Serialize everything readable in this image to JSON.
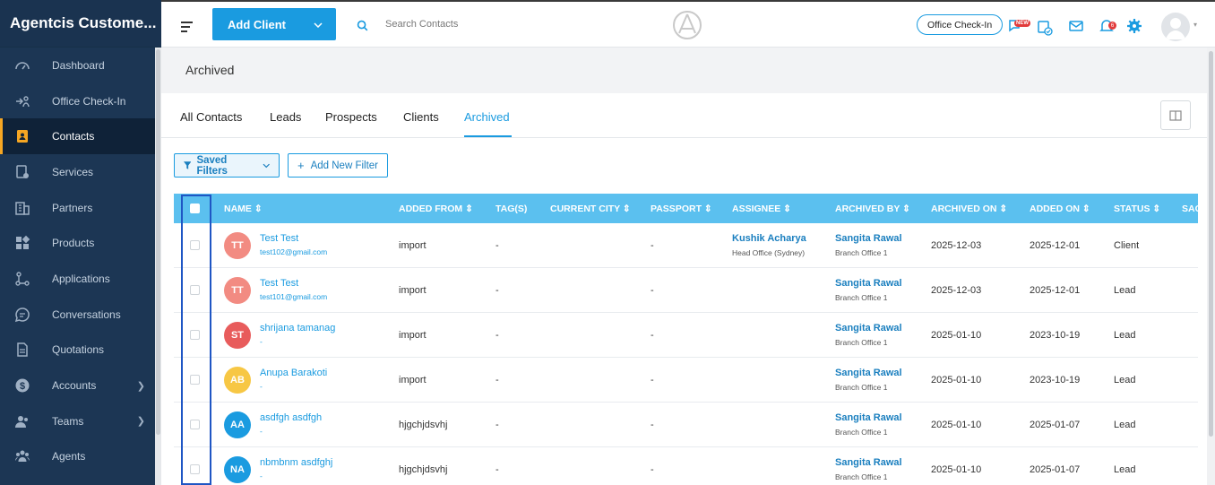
{
  "brand": {
    "title": "Agentcis Custome..."
  },
  "sidebar": {
    "items": [
      {
        "label": "Dashboard",
        "icon": "gauge-icon",
        "active": false,
        "chevron": false
      },
      {
        "label": "Office Check-In",
        "icon": "checkin-icon",
        "active": false,
        "chevron": false
      },
      {
        "label": "Contacts",
        "icon": "contact-card-icon",
        "active": true,
        "chevron": false
      },
      {
        "label": "Services",
        "icon": "services-icon",
        "active": false,
        "chevron": false
      },
      {
        "label": "Partners",
        "icon": "building-icon",
        "active": false,
        "chevron": false
      },
      {
        "label": "Products",
        "icon": "grid-icon",
        "active": false,
        "chevron": false
      },
      {
        "label": "Applications",
        "icon": "flow-icon",
        "active": false,
        "chevron": false
      },
      {
        "label": "Conversations",
        "icon": "chat-icon",
        "active": false,
        "chevron": false
      },
      {
        "label": "Quotations",
        "icon": "document-icon",
        "active": false,
        "chevron": false
      },
      {
        "label": "Accounts",
        "icon": "dollar-icon",
        "active": false,
        "chevron": true
      },
      {
        "label": "Teams",
        "icon": "team-icon",
        "active": false,
        "chevron": true
      },
      {
        "label": "Agents",
        "icon": "agents-icon",
        "active": false,
        "chevron": false
      }
    ]
  },
  "topbar": {
    "add_client_label": "Add Client",
    "search_placeholder": "Search Contacts",
    "office_checkin_label": "Office Check-In",
    "new_badge": "NEW",
    "notification_count": "6"
  },
  "page": {
    "title": "Archived"
  },
  "tabs": [
    {
      "label": "All Contacts"
    },
    {
      "label": "Leads"
    },
    {
      "label": "Prospects"
    },
    {
      "label": "Clients"
    },
    {
      "label": "Archived"
    }
  ],
  "filters": {
    "saved_label": "Saved Filters",
    "add_label": "Add New Filter"
  },
  "table": {
    "headers": {
      "name": "NAME",
      "added_from": "ADDED FROM",
      "tags": "TAG(S)",
      "current_city": "CURRENT CITY",
      "passport": "PASSPORT",
      "assignee": "ASSIGNEE",
      "archived_by": "ARCHIVED BY",
      "archived_on": "ARCHIVED ON",
      "added_on": "ADDED ON",
      "status": "STATUS",
      "sag": "SAG"
    },
    "rows": [
      {
        "initials": "TT",
        "avatar_color": "#f28b82",
        "name": "Test Test",
        "email": "test102@gmail.com",
        "added_from": "import",
        "tags": "-",
        "passport": "-",
        "assignee": "Kushik Acharya",
        "assignee_office": "Head Office (Sydney)",
        "archived_by": "Sangita Rawal",
        "archived_by_office": "Branch Office 1",
        "archived_on": "2025-12-03",
        "added_on": "2025-12-01",
        "status": "Client"
      },
      {
        "initials": "TT",
        "avatar_color": "#f28b82",
        "name": "Test Test",
        "email": "test101@gmail.com",
        "added_from": "import",
        "tags": "-",
        "passport": "-",
        "assignee": "",
        "assignee_office": "",
        "archived_by": "Sangita Rawal",
        "archived_by_office": "Branch Office 1",
        "archived_on": "2025-12-03",
        "added_on": "2025-12-01",
        "status": "Lead"
      },
      {
        "initials": "ST",
        "avatar_color": "#e85c5c",
        "name": "shrijana tamanag",
        "email": "-",
        "added_from": "import",
        "tags": "-",
        "passport": "-",
        "assignee": "",
        "assignee_office": "",
        "archived_by": "Sangita Rawal",
        "archived_by_office": "Branch Office 1",
        "archived_on": "2025-01-10",
        "added_on": "2023-10-19",
        "status": "Lead"
      },
      {
        "initials": "AB",
        "avatar_color": "#f7c744",
        "name": "Anupa Barakoti",
        "email": "-",
        "added_from": "import",
        "tags": "-",
        "passport": "-",
        "assignee": "",
        "assignee_office": "",
        "archived_by": "Sangita Rawal",
        "archived_by_office": "Branch Office 1",
        "archived_on": "2025-01-10",
        "added_on": "2023-10-19",
        "status": "Lead"
      },
      {
        "initials": "AA",
        "avatar_color": "#1a9be0",
        "name": "asdfgh asdfgh",
        "email": "-",
        "added_from": "hjgchjdsvhj",
        "tags": "-",
        "passport": "-",
        "assignee": "",
        "assignee_office": "",
        "archived_by": "Sangita Rawal",
        "archived_by_office": "Branch Office 1",
        "archived_on": "2025-01-10",
        "added_on": "2025-01-07",
        "status": "Lead"
      },
      {
        "initials": "NA",
        "avatar_color": "#1a9be0",
        "name": "nbmbnm asdfghj",
        "email": "-",
        "added_from": "hjgchjdsvhj",
        "tags": "-",
        "passport": "-",
        "assignee": "",
        "assignee_office": "",
        "archived_by": "Sangita Rawal",
        "archived_by_office": "Branch Office 1",
        "archived_on": "2025-01-10",
        "added_on": "2025-01-07",
        "status": "Lead"
      }
    ]
  }
}
